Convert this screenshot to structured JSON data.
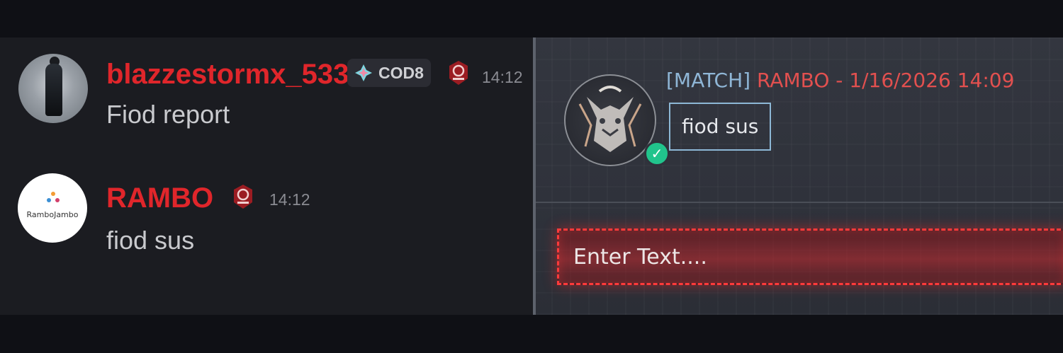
{
  "left_chat": {
    "messages": [
      {
        "username": "blazzestormx_533",
        "tag": "COD8",
        "time": "14:12",
        "text": "Fiod report"
      },
      {
        "username": "RAMBO",
        "avatar_text": "RamboJambo",
        "time": "14:12",
        "text": "fiod sus"
      }
    ]
  },
  "game_chat": {
    "channel": "[MATCH]",
    "sender_line": "RAMBO - 1/16/2026 14:09",
    "message": "fiod sus",
    "input_placeholder": "Enter Text...."
  },
  "colors": {
    "username_red": "#e0262b",
    "game_sender_red": "#e2504f",
    "match_blue": "#8fb6d6",
    "verified_green": "#21c48c",
    "input_red": "#ff3a3a"
  },
  "icons": [
    "cod-tag-icon",
    "clan-badge-icon",
    "wolf-avatar",
    "verified-check-icon"
  ]
}
